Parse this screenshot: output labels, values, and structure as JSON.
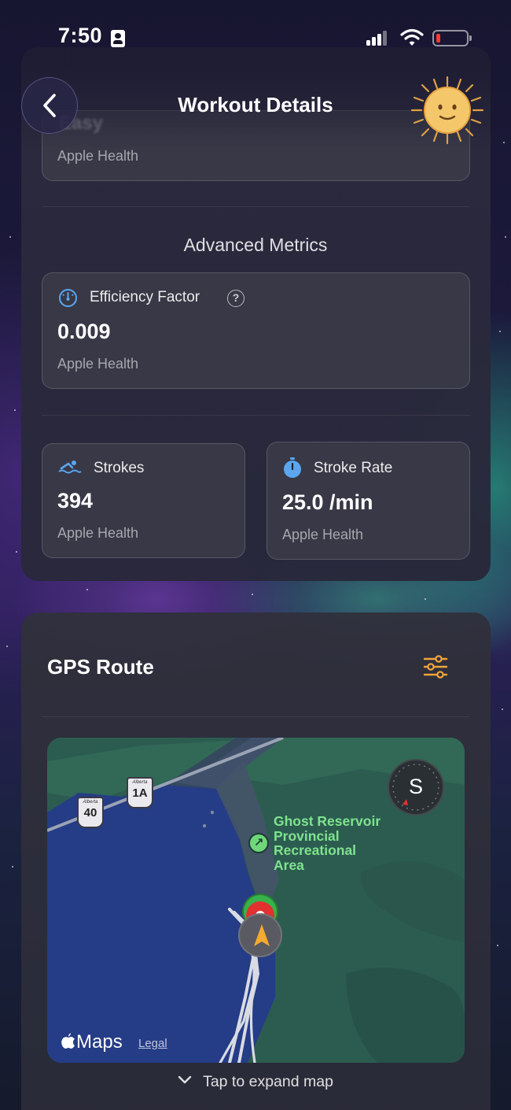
{
  "status_bar": {
    "time": "7:50"
  },
  "header": {
    "title": "Workout Details"
  },
  "previous_card": {
    "ghost_label": "Easy",
    "source": "Apple Health"
  },
  "advanced_metrics": {
    "title": "Advanced Metrics",
    "efficiency": {
      "label": "Efficiency Factor",
      "help": "?",
      "value": "0.009",
      "source": "Apple Health"
    },
    "strokes": {
      "label": "Strokes",
      "value": "394",
      "source": "Apple Health"
    },
    "stroke_rate": {
      "label": "Stroke Rate",
      "value": "25.0 /min",
      "source": "Apple Health"
    }
  },
  "gps": {
    "title": "GPS Route",
    "map": {
      "place_name": "Ghost Reservoir Provincial Recreational Area",
      "place_lines": [
        "Ghost Reservoir",
        "Provincial",
        "Recreational",
        "Area"
      ],
      "highway_1": "40",
      "highway_2": "1A",
      "highway_caption": "Alberta",
      "compass": "S",
      "brand": "Maps",
      "legal": "Legal"
    },
    "expand_label": "Tap to expand map"
  },
  "colors": {
    "accent_orange": "#f0a43a",
    "pin_red": "#e2312f",
    "pin_green": "#38b24a",
    "map_water": "#253c86",
    "map_land": "#2b5b4f"
  }
}
